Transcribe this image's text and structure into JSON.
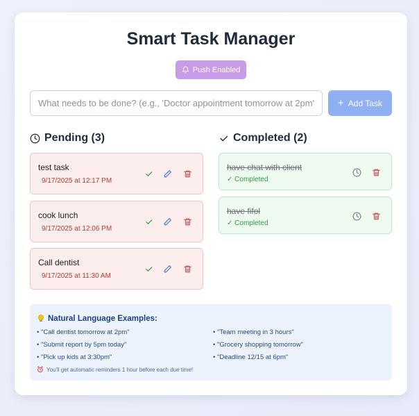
{
  "app": {
    "title": "Smart Task Manager"
  },
  "push": {
    "label": "Push Enabled",
    "icon": "bell-icon"
  },
  "input": {
    "placeholder": "What needs to be done? (e.g., 'Doctor appointment tomorrow at 2pm')",
    "value": ""
  },
  "add_button": {
    "label": "Add Task",
    "icon": "plus-icon"
  },
  "pending": {
    "heading": "Pending (3)",
    "icon": "clock-icon",
    "tasks": [
      {
        "name": "test task",
        "due": "9/17/2025 at 12:17 PM"
      },
      {
        "name": "cook lunch",
        "due": "9/17/2025 at 12:06 PM"
      },
      {
        "name": "Call dentist",
        "due": "9/17/2025 at 11:30 AM"
      }
    ]
  },
  "completed": {
    "heading": "Completed (2)",
    "icon": "check-icon",
    "tasks": [
      {
        "name": "have chat with client",
        "status": "✓ Completed"
      },
      {
        "name": "have fifol",
        "status": "✓ Completed"
      }
    ]
  },
  "examples": {
    "title": "Natural Language Examples:",
    "icon": "lightbulb-icon",
    "left": [
      "• \"Call dentist tomorrow at 2pm\"",
      "• \"Submit report by 5pm today\"",
      "• \"Pick up kids at 3:30pm\""
    ],
    "right": [
      "• \"Team meeting in 3 hours\"",
      "• \"Grocery shopping tomorrow\"",
      "• \"Deadline 12/15 at 6pm\""
    ],
    "note": "You'll get automatic reminders 1 hour before each due time!",
    "note_icon": "alarm-clock-icon"
  },
  "colors": {
    "push_button": "#c79be6",
    "add_button": "#8fb0f3",
    "pending_bg": "#fdeeee",
    "completed_bg": "#effaf1",
    "due_text": "#c0392b",
    "completed_text": "#2e9a46"
  }
}
